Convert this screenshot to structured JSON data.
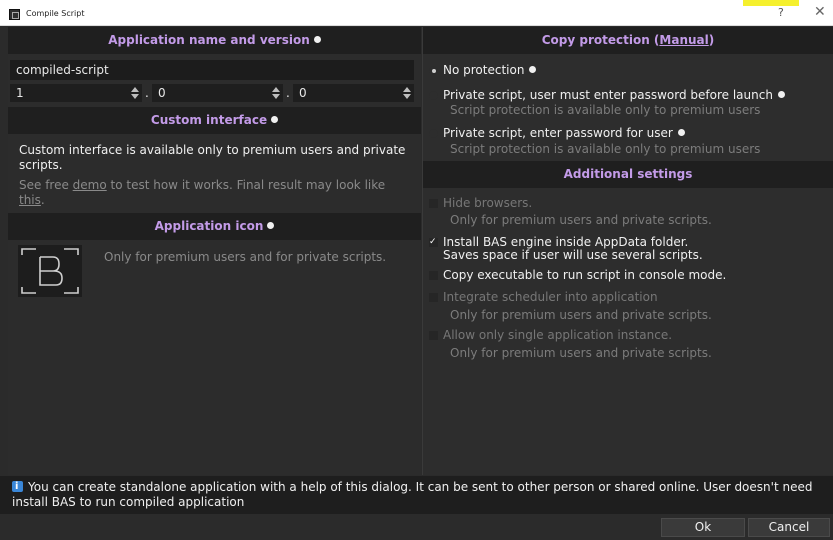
{
  "window": {
    "title": "Compile Script",
    "help_label": "?",
    "close_label": "✕"
  },
  "app_section": {
    "header": "Application name and version",
    "name_value": "compiled-script",
    "version": [
      "1",
      "0",
      "0"
    ],
    "separator": "."
  },
  "custom_interface": {
    "header": "Custom interface",
    "notice": "Custom interface is available only to premium users and private scripts.",
    "see_free": "See free ",
    "demo_link": "demo",
    "demo_rest": " to test how it works. Final result may look like",
    "this_link": "this",
    "period": "."
  },
  "app_icon": {
    "header": "Application icon",
    "notice": "Only for premium users and for private scripts."
  },
  "copy_protection": {
    "header_prefix": "Copy protection (",
    "manual_link": "Manual",
    "header_suffix": ")",
    "options": [
      {
        "label": "No protection",
        "checked": true
      },
      {
        "label": "Private script, user must enter password before launch",
        "sub": "Script protection is available only to premium users"
      },
      {
        "label": "Private script, enter password for user",
        "sub": "Script protection is available only to premium users"
      }
    ]
  },
  "additional": {
    "header": "Additional settings",
    "items": [
      {
        "label": "Hide browsers.",
        "sub": "Only for premium users and private scripts.",
        "enabled": false,
        "checked": false
      },
      {
        "label": "Install BAS engine inside AppData folder.",
        "label2": "Saves space if user will use several scripts.",
        "enabled": true,
        "checked": true
      },
      {
        "label": "Copy executable to run script in console mode.",
        "enabled": true,
        "checked": false
      },
      {
        "label": "Integrate scheduler into application",
        "sub": "Only for premium users and private scripts.",
        "enabled": false,
        "checked": false
      },
      {
        "label": "Allow only single application instance.",
        "sub": "Only for premium users and private scripts.",
        "enabled": false,
        "checked": false
      }
    ]
  },
  "info": {
    "text": "You can create standalone application with a help of this dialog. It can be sent to other person or shared online. User doesn't need install BAS to run compiled application"
  },
  "buttons": {
    "ok": "Ok",
    "cancel": "Cancel"
  },
  "colors": {
    "accent": "#c39be8",
    "background": "#2b2b2b",
    "header_bg": "#1f1f1f",
    "info_icon": "#3a87d8"
  }
}
